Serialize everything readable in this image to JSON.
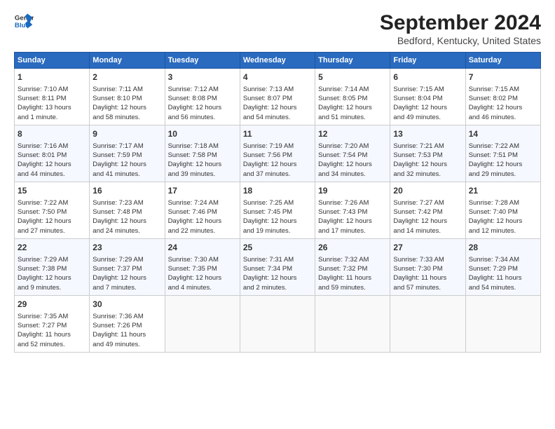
{
  "logo": {
    "line1": "General",
    "line2": "Blue"
  },
  "title": "September 2024",
  "subtitle": "Bedford, Kentucky, United States",
  "header_days": [
    "Sunday",
    "Monday",
    "Tuesday",
    "Wednesday",
    "Thursday",
    "Friday",
    "Saturday"
  ],
  "weeks": [
    [
      {
        "day": "1",
        "lines": [
          "Sunrise: 7:10 AM",
          "Sunset: 8:11 PM",
          "Daylight: 13 hours",
          "and 1 minute."
        ]
      },
      {
        "day": "2",
        "lines": [
          "Sunrise: 7:11 AM",
          "Sunset: 8:10 PM",
          "Daylight: 12 hours",
          "and 58 minutes."
        ]
      },
      {
        "day": "3",
        "lines": [
          "Sunrise: 7:12 AM",
          "Sunset: 8:08 PM",
          "Daylight: 12 hours",
          "and 56 minutes."
        ]
      },
      {
        "day": "4",
        "lines": [
          "Sunrise: 7:13 AM",
          "Sunset: 8:07 PM",
          "Daylight: 12 hours",
          "and 54 minutes."
        ]
      },
      {
        "day": "5",
        "lines": [
          "Sunrise: 7:14 AM",
          "Sunset: 8:05 PM",
          "Daylight: 12 hours",
          "and 51 minutes."
        ]
      },
      {
        "day": "6",
        "lines": [
          "Sunrise: 7:15 AM",
          "Sunset: 8:04 PM",
          "Daylight: 12 hours",
          "and 49 minutes."
        ]
      },
      {
        "day": "7",
        "lines": [
          "Sunrise: 7:15 AM",
          "Sunset: 8:02 PM",
          "Daylight: 12 hours",
          "and 46 minutes."
        ]
      }
    ],
    [
      {
        "day": "8",
        "lines": [
          "Sunrise: 7:16 AM",
          "Sunset: 8:01 PM",
          "Daylight: 12 hours",
          "and 44 minutes."
        ]
      },
      {
        "day": "9",
        "lines": [
          "Sunrise: 7:17 AM",
          "Sunset: 7:59 PM",
          "Daylight: 12 hours",
          "and 41 minutes."
        ]
      },
      {
        "day": "10",
        "lines": [
          "Sunrise: 7:18 AM",
          "Sunset: 7:58 PM",
          "Daylight: 12 hours",
          "and 39 minutes."
        ]
      },
      {
        "day": "11",
        "lines": [
          "Sunrise: 7:19 AM",
          "Sunset: 7:56 PM",
          "Daylight: 12 hours",
          "and 37 minutes."
        ]
      },
      {
        "day": "12",
        "lines": [
          "Sunrise: 7:20 AM",
          "Sunset: 7:54 PM",
          "Daylight: 12 hours",
          "and 34 minutes."
        ]
      },
      {
        "day": "13",
        "lines": [
          "Sunrise: 7:21 AM",
          "Sunset: 7:53 PM",
          "Daylight: 12 hours",
          "and 32 minutes."
        ]
      },
      {
        "day": "14",
        "lines": [
          "Sunrise: 7:22 AM",
          "Sunset: 7:51 PM",
          "Daylight: 12 hours",
          "and 29 minutes."
        ]
      }
    ],
    [
      {
        "day": "15",
        "lines": [
          "Sunrise: 7:22 AM",
          "Sunset: 7:50 PM",
          "Daylight: 12 hours",
          "and 27 minutes."
        ]
      },
      {
        "day": "16",
        "lines": [
          "Sunrise: 7:23 AM",
          "Sunset: 7:48 PM",
          "Daylight: 12 hours",
          "and 24 minutes."
        ]
      },
      {
        "day": "17",
        "lines": [
          "Sunrise: 7:24 AM",
          "Sunset: 7:46 PM",
          "Daylight: 12 hours",
          "and 22 minutes."
        ]
      },
      {
        "day": "18",
        "lines": [
          "Sunrise: 7:25 AM",
          "Sunset: 7:45 PM",
          "Daylight: 12 hours",
          "and 19 minutes."
        ]
      },
      {
        "day": "19",
        "lines": [
          "Sunrise: 7:26 AM",
          "Sunset: 7:43 PM",
          "Daylight: 12 hours",
          "and 17 minutes."
        ]
      },
      {
        "day": "20",
        "lines": [
          "Sunrise: 7:27 AM",
          "Sunset: 7:42 PM",
          "Daylight: 12 hours",
          "and 14 minutes."
        ]
      },
      {
        "day": "21",
        "lines": [
          "Sunrise: 7:28 AM",
          "Sunset: 7:40 PM",
          "Daylight: 12 hours",
          "and 12 minutes."
        ]
      }
    ],
    [
      {
        "day": "22",
        "lines": [
          "Sunrise: 7:29 AM",
          "Sunset: 7:38 PM",
          "Daylight: 12 hours",
          "and 9 minutes."
        ]
      },
      {
        "day": "23",
        "lines": [
          "Sunrise: 7:29 AM",
          "Sunset: 7:37 PM",
          "Daylight: 12 hours",
          "and 7 minutes."
        ]
      },
      {
        "day": "24",
        "lines": [
          "Sunrise: 7:30 AM",
          "Sunset: 7:35 PM",
          "Daylight: 12 hours",
          "and 4 minutes."
        ]
      },
      {
        "day": "25",
        "lines": [
          "Sunrise: 7:31 AM",
          "Sunset: 7:34 PM",
          "Daylight: 12 hours",
          "and 2 minutes."
        ]
      },
      {
        "day": "26",
        "lines": [
          "Sunrise: 7:32 AM",
          "Sunset: 7:32 PM",
          "Daylight: 11 hours",
          "and 59 minutes."
        ]
      },
      {
        "day": "27",
        "lines": [
          "Sunrise: 7:33 AM",
          "Sunset: 7:30 PM",
          "Daylight: 11 hours",
          "and 57 minutes."
        ]
      },
      {
        "day": "28",
        "lines": [
          "Sunrise: 7:34 AM",
          "Sunset: 7:29 PM",
          "Daylight: 11 hours",
          "and 54 minutes."
        ]
      }
    ],
    [
      {
        "day": "29",
        "lines": [
          "Sunrise: 7:35 AM",
          "Sunset: 7:27 PM",
          "Daylight: 11 hours",
          "and 52 minutes."
        ]
      },
      {
        "day": "30",
        "lines": [
          "Sunrise: 7:36 AM",
          "Sunset: 7:26 PM",
          "Daylight: 11 hours",
          "and 49 minutes."
        ]
      },
      null,
      null,
      null,
      null,
      null
    ]
  ]
}
